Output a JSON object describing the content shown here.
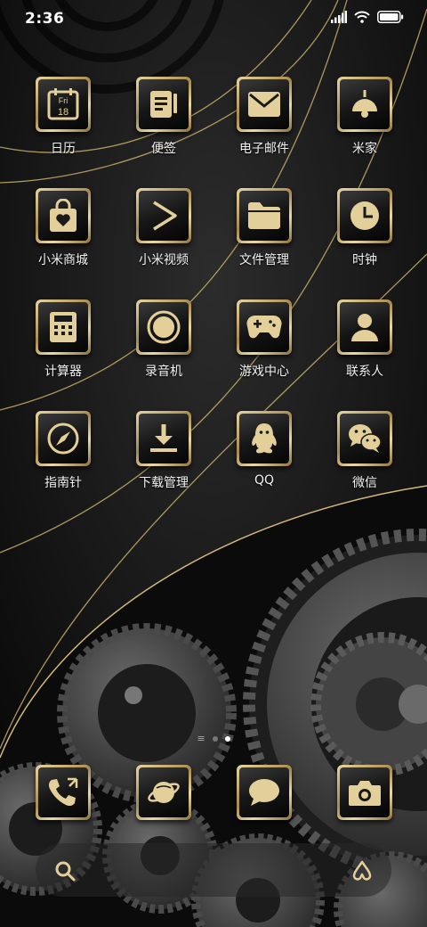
{
  "status": {
    "time": "2:36"
  },
  "apps": [
    {
      "name": "calendar",
      "label": "日历",
      "icon": "calendar-icon",
      "date_day": "Fri",
      "date_num": "18"
    },
    {
      "name": "notes",
      "label": "便签",
      "icon": "notes-icon"
    },
    {
      "name": "email",
      "label": "电子邮件",
      "icon": "mail-icon"
    },
    {
      "name": "mijia",
      "label": "米家",
      "icon": "lamp-icon"
    },
    {
      "name": "mi-store",
      "label": "小米商城",
      "icon": "shopping-bag-icon"
    },
    {
      "name": "mi-video",
      "label": "小米视频",
      "icon": "play-icon"
    },
    {
      "name": "file-manager",
      "label": "文件管理",
      "icon": "folder-icon"
    },
    {
      "name": "clock",
      "label": "时钟",
      "icon": "clock-icon"
    },
    {
      "name": "calculator",
      "label": "计算器",
      "icon": "calculator-icon"
    },
    {
      "name": "recorder",
      "label": "录音机",
      "icon": "record-icon"
    },
    {
      "name": "game-center",
      "label": "游戏中心",
      "icon": "gamepad-icon"
    },
    {
      "name": "contacts",
      "label": "联系人",
      "icon": "person-icon"
    },
    {
      "name": "compass",
      "label": "指南针",
      "icon": "compass-icon"
    },
    {
      "name": "downloads",
      "label": "下载管理",
      "icon": "download-icon"
    },
    {
      "name": "qq",
      "label": "QQ",
      "icon": "penguin-icon"
    },
    {
      "name": "wechat",
      "label": "微信",
      "icon": "wechat-icon"
    }
  ],
  "dock": [
    {
      "name": "phone",
      "icon": "phone-icon"
    },
    {
      "name": "browser",
      "icon": "planet-icon"
    },
    {
      "name": "messages",
      "icon": "chat-bubble-icon"
    },
    {
      "name": "camera",
      "icon": "camera-icon"
    }
  ],
  "page_indicator": {
    "pages": 2,
    "current": 2
  },
  "dock_bar": {
    "left_icon": "search-icon",
    "right_icon": "assistant-icon"
  },
  "colors": {
    "gold": "#e3cf99",
    "gold_dark": "#a88a4c",
    "background": "#141414"
  }
}
